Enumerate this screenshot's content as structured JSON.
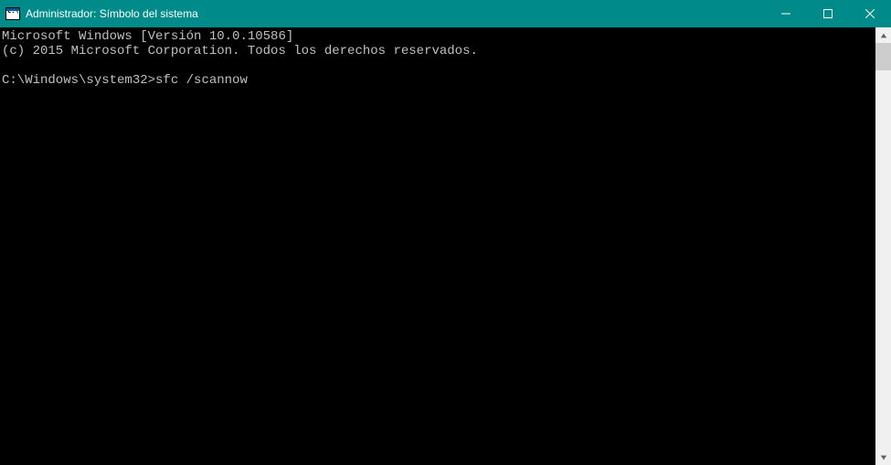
{
  "titlebar": {
    "title": "Administrador: Símbolo del sistema"
  },
  "terminal": {
    "line1": "Microsoft Windows [Versión 10.0.10586]",
    "line2": "(c) 2015 Microsoft Corporation. Todos los derechos reservados.",
    "blank": "",
    "prompt": "C:\\Windows\\system32>",
    "command": "sfc /scannow"
  }
}
